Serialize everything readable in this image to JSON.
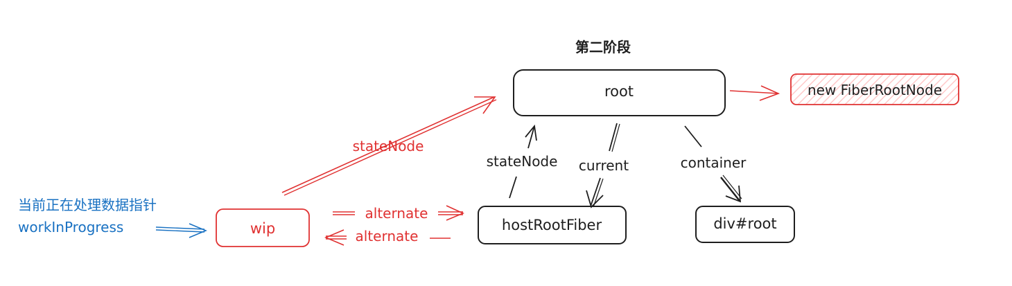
{
  "diagram": {
    "title": "第二阶段",
    "nodes": {
      "root": {
        "label": "root"
      },
      "new_fiber_root_node": {
        "label": "new FiberRootNode"
      },
      "host_root_fiber": {
        "label": "hostRootFiber"
      },
      "div_root": {
        "label": "div#root"
      },
      "wip": {
        "label": "wip"
      }
    },
    "edges": {
      "wip_to_root": {
        "label": "stateNode"
      },
      "host_to_root": {
        "label": "stateNode"
      },
      "root_to_host": {
        "label": "current"
      },
      "root_to_div": {
        "label": "container"
      },
      "wip_to_host": {
        "label": "alternate"
      },
      "host_to_wip": {
        "label": "alternate"
      }
    },
    "note": {
      "line1": "当前正在处理数据指针",
      "line2": "workInProgress"
    },
    "colors": {
      "ink": "#1e1e1e",
      "red": "#e03131",
      "red_hatch": "#ffc9c9",
      "blue": "#1971c2"
    }
  }
}
